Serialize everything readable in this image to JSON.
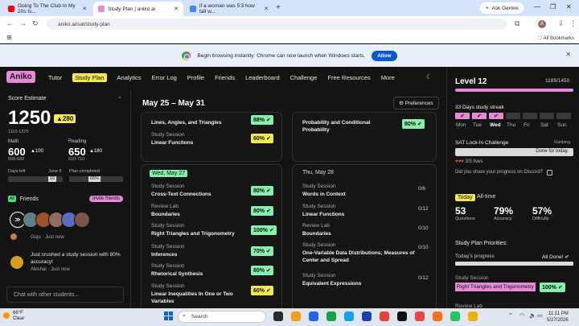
{
  "browser": {
    "tabs": [
      {
        "title": "Going To The Club In My 20s Is...",
        "favicon_color": "#ff0000"
      },
      {
        "title": "Study Plan | aniko.ai",
        "favicon_color": "#e58bd6"
      },
      {
        "title": "if a woman was 5'3 how tall w...",
        "favicon_color": "#4285f4"
      }
    ],
    "gemini_label": "Ask Gemini",
    "url": "aniko.ai/sat/study-plan",
    "avatar_letter": "A",
    "all_bookmarks": "All Bookmarks",
    "infobar_text": "Begin browsing instantly: Chrome can now launch when Windows starts.",
    "allow_label": "Allow"
  },
  "app": {
    "logo": "Aniko",
    "nav": [
      "Tutor",
      "Study Plan",
      "Analytics",
      "Error Log",
      "Profile",
      "Friends",
      "Leaderboard",
      "Challenge",
      "Free Resources",
      "More"
    ],
    "active_nav": "Study Plan"
  },
  "score": {
    "title": "Score Estimate",
    "total": "1250",
    "total_delta": "▲280",
    "total_range": "1110-1370",
    "math_label": "Math",
    "math": "600",
    "math_delta": "▲100",
    "math_range": "500-660",
    "reading_label": "Reading",
    "reading": "650",
    "reading_delta": "▲180",
    "reading_range": "610-710",
    "days_left_label": "Days left",
    "test_date": "June 6",
    "days_left": "10",
    "plan_label": "Plan completed",
    "plan_pct": "65%",
    "plan_fraction": 0.65,
    "days_left_fraction": 0.3
  },
  "friends": {
    "title": "Friends",
    "invite_label": "Invite friends",
    "avatar_count": 6,
    "feed": [
      {
        "name": "Goju",
        "time": "Just now"
      },
      {
        "name": "Abishai",
        "time": "Just now",
        "text": "Just crushed a study session with 80% accuracy!"
      }
    ],
    "chat_placeholder": "Chat with other students..."
  },
  "week": {
    "range": "May 25 – May 31",
    "preferences": "Preferences",
    "days": [
      {
        "label": "",
        "sessions": [
          {
            "type": "",
            "title": "Lines, Angles, and Triangles",
            "score": "88%",
            "color": "green"
          },
          {
            "type": "Study Session",
            "title": "Linear Functions",
            "score": "60%",
            "color": "yellow"
          }
        ]
      },
      {
        "label": "",
        "sessions": [
          {
            "type": "",
            "title": "Probability and Conditional Probability",
            "score": "80%",
            "color": "green"
          }
        ]
      },
      {
        "label": "Wed, May 27",
        "sessions": [
          {
            "type": "Study Session",
            "title": "Cross-Text Connections",
            "score": "80%",
            "color": "green"
          },
          {
            "type": "Review Lab",
            "title": "Boundaries",
            "score": "80%",
            "color": "green"
          },
          {
            "type": "Study Session",
            "title": "Right Triangles and Trigonometry",
            "score": "100%",
            "color": "green"
          },
          {
            "type": "Study Session",
            "title": "Inferences",
            "score": "70%",
            "color": "green"
          },
          {
            "type": "Study Session",
            "title": "Rhetorical Synthesis",
            "score": "80%",
            "color": "green"
          },
          {
            "type": "Study Session",
            "title": "Linear Inequalities In One or Two Variables",
            "score": "60%",
            "color": "yellow"
          }
        ]
      },
      {
        "label": "Thu, May 28",
        "sessions": [
          {
            "type": "Study Session",
            "title": "Words in Context",
            "frac": "0/6"
          },
          {
            "type": "Study Session",
            "title": "Linear Functions",
            "frac": "0/12"
          },
          {
            "type": "Review Lab",
            "title": "Boundaries",
            "frac": "0/10"
          },
          {
            "type": "Study Session",
            "title": "One-Variable Data Distributions; Measures of Center and Spread",
            "frac": "0/10"
          },
          {
            "type": "Study Session",
            "title": "Equivalent Expressions",
            "frac": "0/12"
          }
        ]
      }
    ]
  },
  "right": {
    "level": "Level 12",
    "xp": "1189/1450",
    "xp_fraction": 0.82,
    "streak_label": "33 Days study streak",
    "streak_days": [
      "Mon",
      "Tue",
      "Wed",
      "Thu",
      "Fri",
      "Sat",
      "Sun"
    ],
    "streak_done": [
      true,
      true,
      true,
      false,
      false,
      false,
      false
    ],
    "lockin_label": "SAT Lock-In Challenge",
    "ranking_label": "Ranking",
    "lockin_status": "Done for today.",
    "lives": "3/3 lives",
    "discord_q": "Did you share your progress on Discord?",
    "today_tag": "Today",
    "alltime_tag": "All-time",
    "stats": [
      {
        "value": "53",
        "label": "Questions"
      },
      {
        "value": "79%",
        "label": "Accuracy"
      },
      {
        "value": "57%",
        "label": "Difficulty"
      }
    ],
    "priorities_title": "Study Plan Priorities:",
    "today_progress": "Today's progress",
    "all_done": "All Done!",
    "session_type": "Study Session",
    "session_title": "Right Triangles and Trigonometry",
    "session_score": "100%",
    "review_label": "Review Lab"
  },
  "taskbar": {
    "temp": "66°F",
    "weather": "Clear",
    "search": "Search",
    "time": "11:11 PM",
    "date": "5/27/2026"
  }
}
